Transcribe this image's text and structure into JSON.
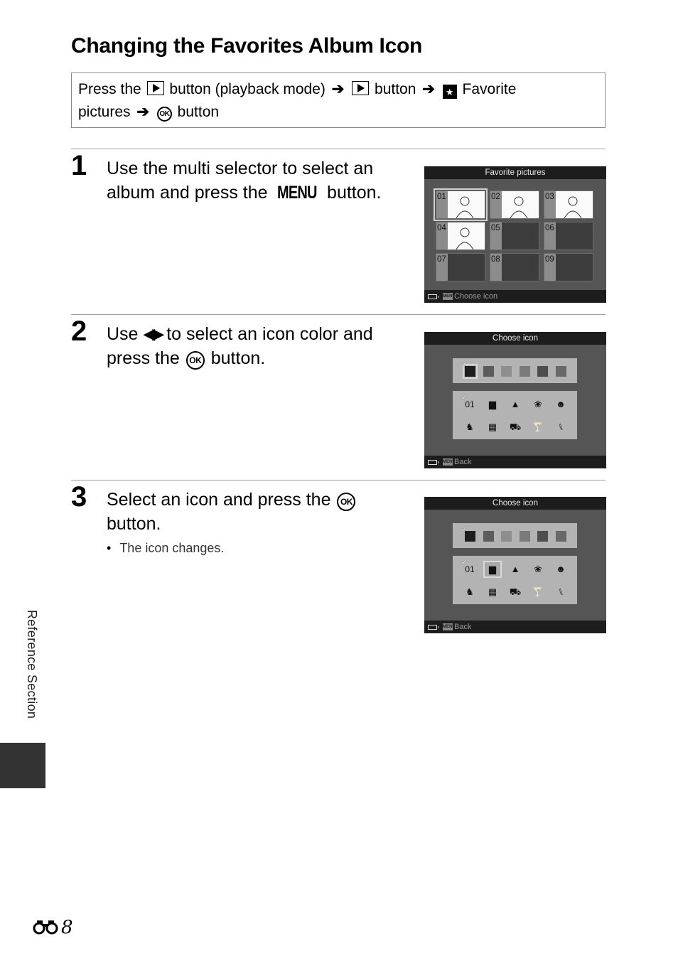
{
  "page": {
    "title": "Changing the Favorites Album Icon",
    "side_tab": "Reference Section",
    "page_number": "8",
    "page_prefix_icon": "binoculars-icon"
  },
  "path_box": {
    "t1": "Press the",
    "t2": "button (playback mode)",
    "t3": "button",
    "t4": "Favorite",
    "t5": "pictures",
    "t6": "button",
    "play_icon": "playback-button-icon",
    "fav_icon": "favorite-pictures-icon",
    "ok_label": "OK",
    "arrow": "➔",
    "star": "★"
  },
  "steps": [
    {
      "number": "1",
      "text_a": "Use the multi selector to select an album and press the",
      "menu_word": "MENU",
      "text_b": "button."
    },
    {
      "number": "2",
      "text_a": "Use",
      "arrows": "◀▶",
      "text_b": "to select an icon color and press the",
      "ok_label": "OK",
      "text_c": "button."
    },
    {
      "number": "3",
      "text_a": "Select an icon and press the",
      "ok_label": "OK",
      "text_b": "button.",
      "bullet": "The icon changes."
    }
  ],
  "screens": {
    "favorites": {
      "header": "Favorite pictures",
      "footer_menu_badge": "MENU",
      "footer_label": "Choose icon",
      "albums": [
        {
          "num": "01",
          "has_image": true,
          "selected": true
        },
        {
          "num": "02",
          "has_image": true,
          "selected": false
        },
        {
          "num": "03",
          "has_image": true,
          "selected": false
        },
        {
          "num": "04",
          "has_image": true,
          "selected": false
        },
        {
          "num": "05",
          "has_image": false,
          "selected": false
        },
        {
          "num": "06",
          "has_image": false,
          "selected": false
        },
        {
          "num": "07",
          "has_image": false,
          "selected": false
        },
        {
          "num": "08",
          "has_image": false,
          "selected": false
        },
        {
          "num": "09",
          "has_image": false,
          "selected": false
        }
      ]
    },
    "choose_icon_color": {
      "header": "Choose icon",
      "footer_menu_badge": "MENU",
      "footer_label": "Back",
      "selected_icon_index": 0
    },
    "choose_icon_select": {
      "header": "Choose icon",
      "footer_menu_badge": "MENU",
      "footer_label": "Back",
      "selected_icon_index": 1
    },
    "colors": [
      "#1e1e1e",
      "#5c5c5c",
      "#8e8e8e",
      "#7a7a7a",
      "#4e4e4e",
      "#686868"
    ],
    "selected_color_index": 0,
    "check_mark": "✓",
    "icons": [
      {
        "name": "number-01-icon",
        "glyph": "01"
      },
      {
        "name": "briefcase-icon",
        "glyph": "▆"
      },
      {
        "name": "mountain-icon",
        "glyph": "▲"
      },
      {
        "name": "flower-icon",
        "glyph": "❀"
      },
      {
        "name": "face-icon",
        "glyph": "☻"
      },
      {
        "name": "pet-icon",
        "glyph": "♞"
      },
      {
        "name": "building-icon",
        "glyph": "▦"
      },
      {
        "name": "car-icon",
        "glyph": "⛟"
      },
      {
        "name": "cocktail-icon",
        "glyph": "🍸"
      },
      {
        "name": "fork-knife-icon",
        "glyph": "⑊"
      }
    ]
  }
}
